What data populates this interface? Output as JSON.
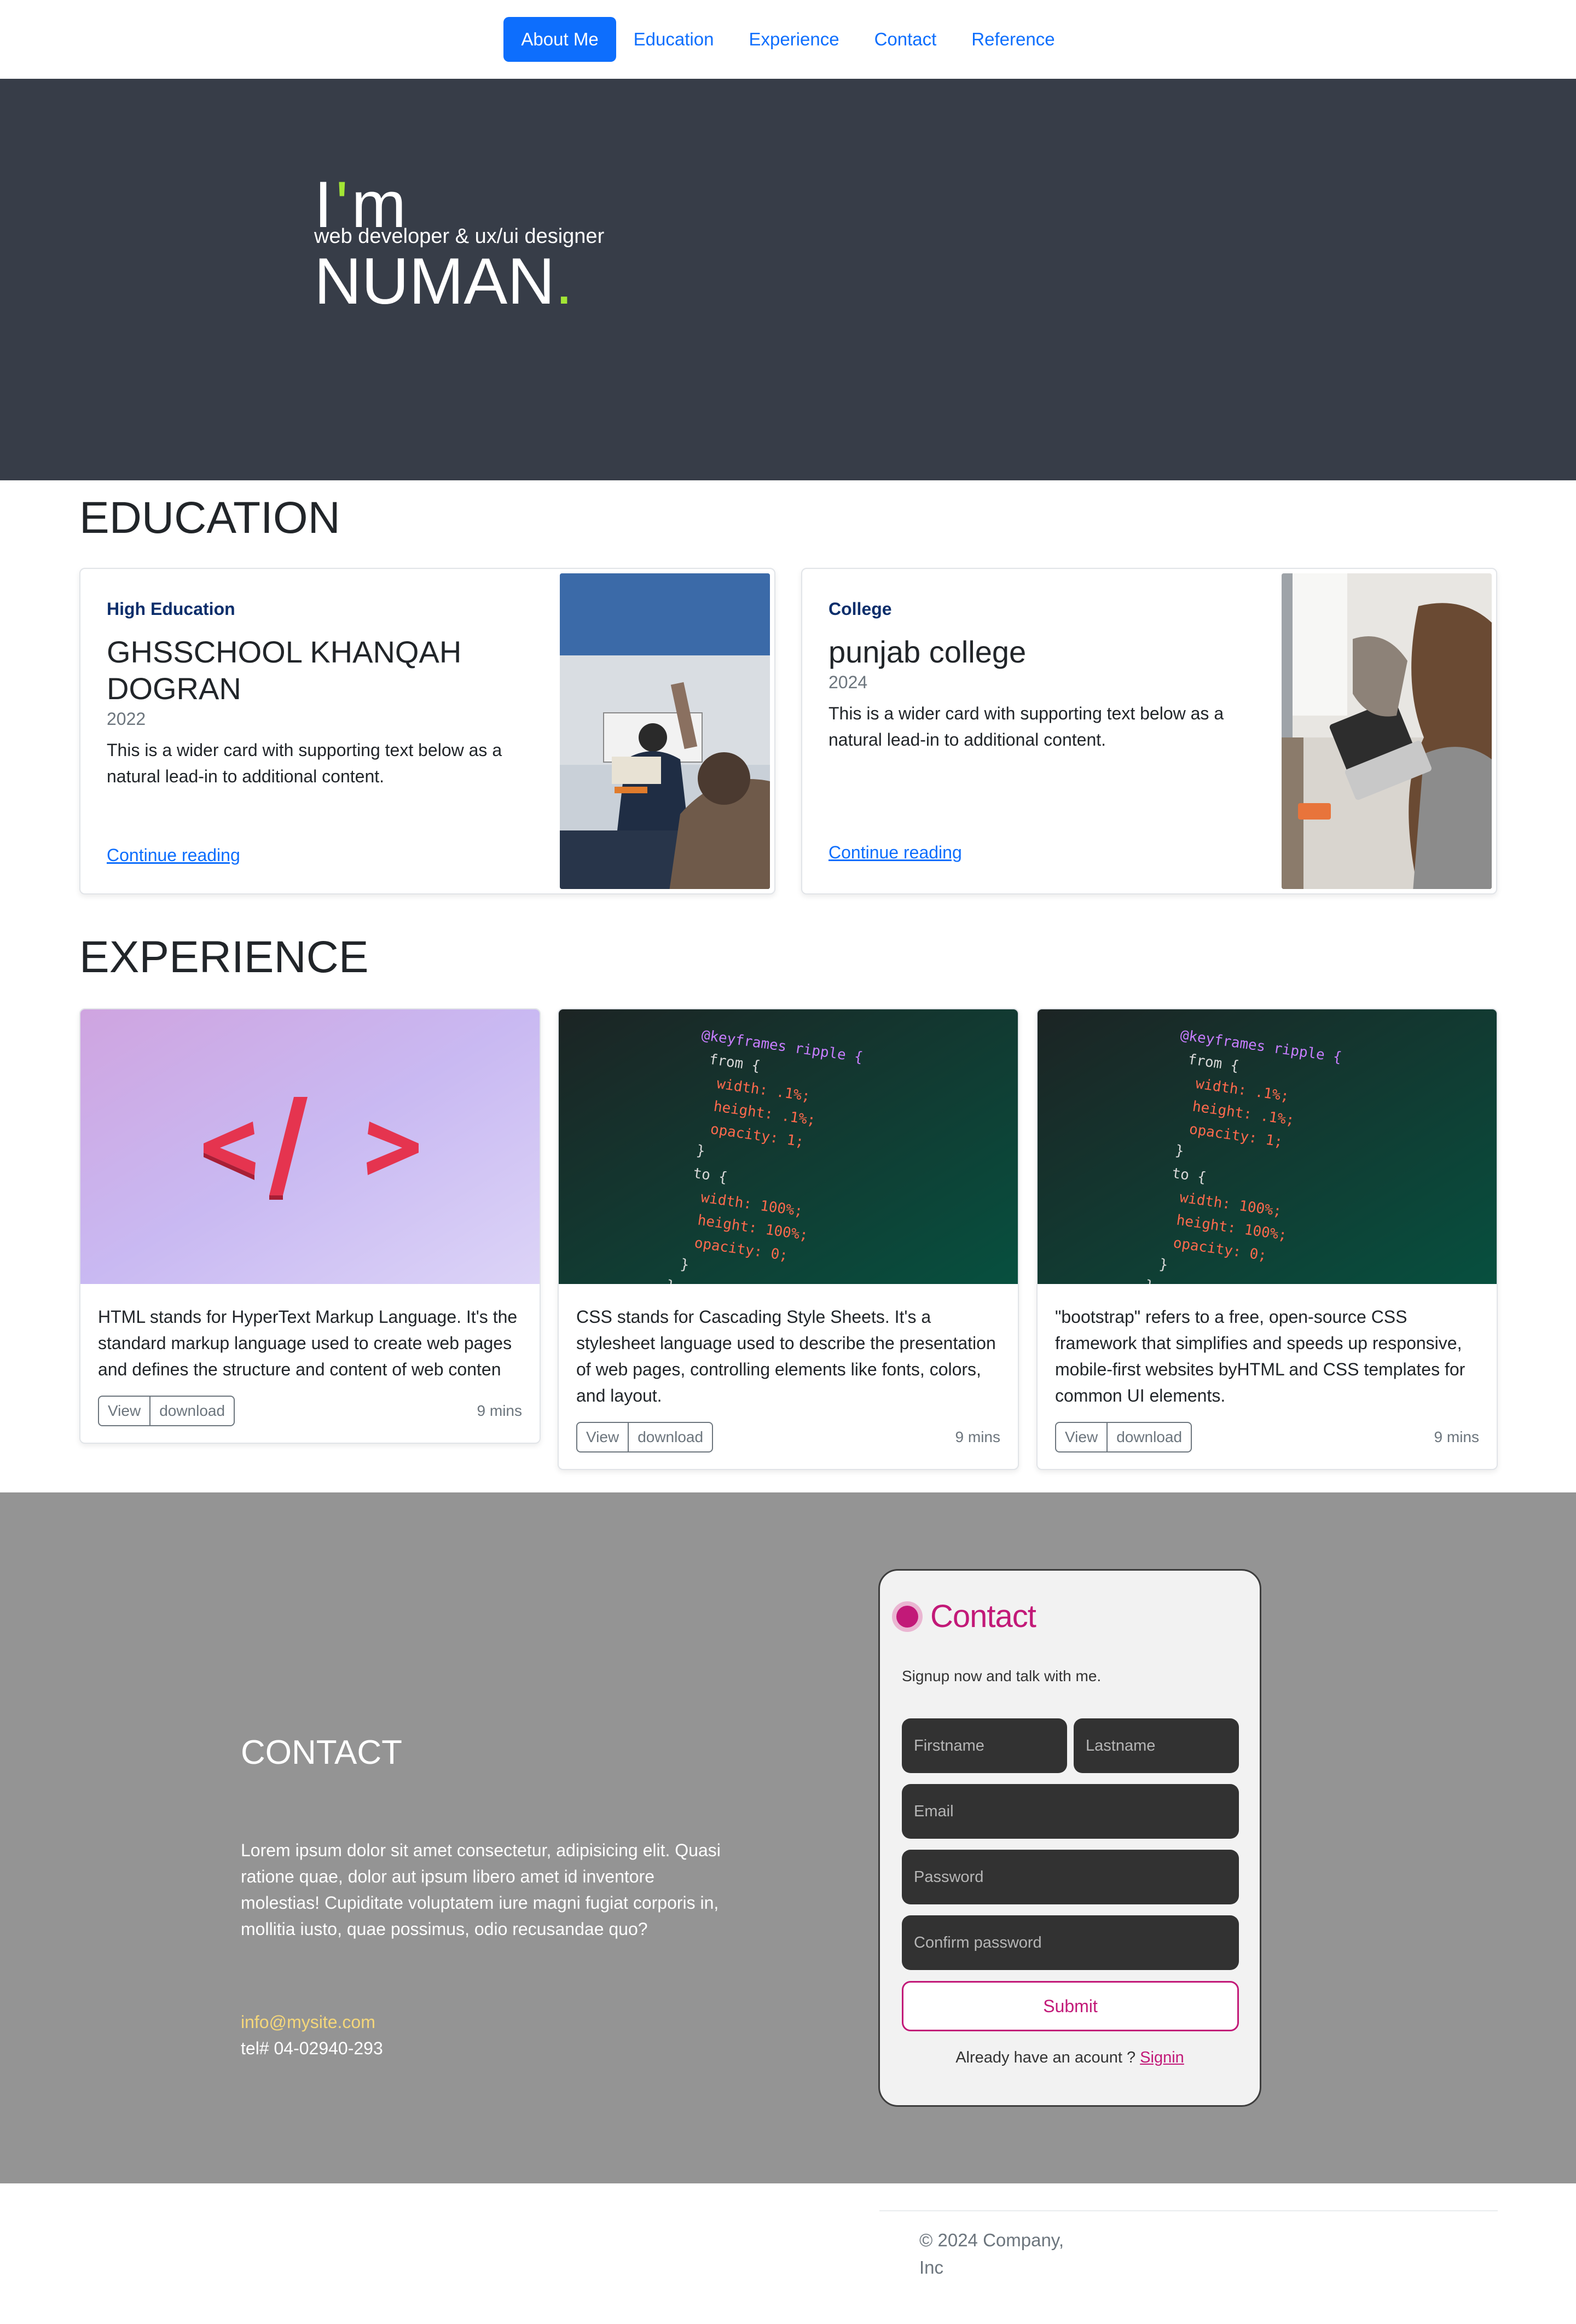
{
  "nav": {
    "items": [
      {
        "label": "About Me",
        "active": true
      },
      {
        "label": "Education",
        "active": false
      },
      {
        "label": "Experience",
        "active": false
      },
      {
        "label": "Contact",
        "active": false
      },
      {
        "label": "Reference",
        "active": false
      }
    ]
  },
  "hero": {
    "im_prefix": "I",
    "im_tick": "'",
    "im_suffix": "m",
    "subtitle": "web developer & ux/ui designer",
    "name": "NUMAN",
    "name_dot": ".",
    "accent_color": "#a3e635",
    "bg_color": "#373d48"
  },
  "education": {
    "title": "EDUCATION",
    "cards": [
      {
        "category": "High Education",
        "title": "GHSSCHOOL KHANQAH DOGRAN",
        "year": "2022",
        "text": "This is a wider card with supporting text below as a natural lead-in to additional content.",
        "link": "Continue reading",
        "image": "classroom-photo"
      },
      {
        "category": "College",
        "title": "punjab college",
        "year": "2024",
        "text": "This is a wider card with supporting text below as a natural lead-in to additional content.",
        "link": "Continue reading",
        "image": "laptop-study-photo"
      }
    ]
  },
  "experience": {
    "title": "EXPERIENCE",
    "cards": [
      {
        "image": "code-symbol-photo",
        "text": "HTML stands for HyperText Markup Language. It's the standard markup language used to create web pages and defines the structure and content of web conten",
        "view": "View",
        "download": "download",
        "time": "9 mins"
      },
      {
        "image": "css-code-photo",
        "text": "CSS stands for Cascading Style Sheets. It's a stylesheet language used to describe the presentation of web pages, controlling elements like fonts, colors, and layout.",
        "view": "View",
        "download": "download",
        "time": "9 mins"
      },
      {
        "image": "css-code-photo",
        "text": "\"bootstrap\" refers to a free, open-source CSS framework that simplifies and speeds up responsive, mobile-first websites byHTML and CSS templates for common UI elements.",
        "view": "View",
        "download": "download",
        "time": "9 mins"
      }
    ],
    "code_lines": [
      "@keyframes ripple {",
      "from {",
      "width: .1%;",
      "height: .1%;",
      "opacity: 1;",
      "}",
      "to {",
      "width: 100%;",
      "height: 100%;",
      "opacity: 0;",
      "}",
      "}"
    ]
  },
  "contact": {
    "title": "CONTACT",
    "lead": "Lorem ipsum dolor sit amet consectetur, adipisicing elit. Quasi ratione quae, dolor aut ipsum libero amet id inventore molestias! Cupiditate voluptatem iure magni fugiat corporis in, mollitia iusto, quae possimus, odio recusandae quo?",
    "email": "info@mysite.com",
    "tel": "tel# 04-02940-293",
    "bg_color": "#949494",
    "form": {
      "title": "Contact",
      "subtitle": "Signup now and talk with me.",
      "firstname": "Firstname",
      "lastname": "Lastname",
      "email": "Email",
      "password": "Password",
      "confirm": "Confirm password",
      "submit": "Submit",
      "footer_text": "Already have an acount ? ",
      "signin": "Signin",
      "accent_color": "#c21978"
    }
  },
  "footer": {
    "copyright": "© 2024 Company, Inc"
  }
}
